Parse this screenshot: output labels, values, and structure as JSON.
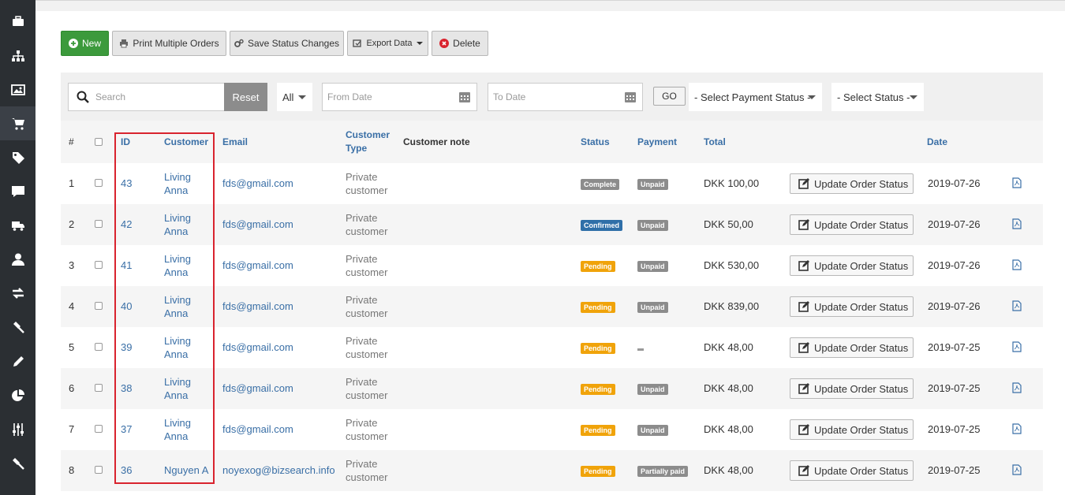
{
  "sidebar": {
    "icons": [
      "briefcase-icon",
      "sitemap-icon",
      "image-icon",
      "cart-icon",
      "tag-icon",
      "comment-icon",
      "truck-icon",
      "user-icon",
      "exchange-icon",
      "gavel-icon",
      "pencil-icon",
      "pie-chart-icon",
      "sliders-icon",
      "hammer-icon"
    ],
    "active_index": 3
  },
  "toolbar": {
    "new_label": "New",
    "print_label": "Print Multiple Orders",
    "save_label": "Save Status Changes",
    "export_label": "Export Data",
    "delete_label": "Delete"
  },
  "filters": {
    "search_placeholder": "Search",
    "reset_label": "Reset",
    "all_label": "All",
    "from_date_placeholder": "From Date",
    "to_date_placeholder": "To Date",
    "go_label": "GO",
    "payment_status_label": "- Select Payment Status -",
    "status_label": "- Select Status -"
  },
  "table": {
    "headers": {
      "num": "#",
      "id": "ID",
      "customer": "Customer",
      "email": "Email",
      "customer_type": "Customer Type",
      "customer_note": "Customer note",
      "status": "Status",
      "payment": "Payment",
      "total": "Total",
      "date": "Date"
    },
    "update_label": "Update Order Status",
    "rows": [
      {
        "num": "1",
        "id": "43",
        "customer": "Living Anna",
        "email": "fds@gmail.com",
        "type": "Private customer",
        "status": "Complete",
        "payment": "Unpaid",
        "total": "DKK 100,00",
        "date": "2019-07-26"
      },
      {
        "num": "2",
        "id": "42",
        "customer": "Living Anna",
        "email": "fds@gmail.com",
        "type": "Private customer",
        "status": "Confirmed",
        "payment": "Unpaid",
        "total": "DKK 50,00",
        "date": "2019-07-26"
      },
      {
        "num": "3",
        "id": "41",
        "customer": "Living Anna",
        "email": "fds@gmail.com",
        "type": "Private customer",
        "status": "Pending",
        "payment": "Unpaid",
        "total": "DKK 530,00",
        "date": "2019-07-26"
      },
      {
        "num": "4",
        "id": "40",
        "customer": "Living Anna",
        "email": "fds@gmail.com",
        "type": "Private customer",
        "status": "Pending",
        "payment": "Unpaid",
        "total": "DKK 839,00",
        "date": "2019-07-26"
      },
      {
        "num": "5",
        "id": "39",
        "customer": "Living Anna",
        "email": "fds@gmail.com",
        "type": "Private customer",
        "status": "Pending",
        "payment": "",
        "total": "DKK 48,00",
        "date": "2019-07-25"
      },
      {
        "num": "6",
        "id": "38",
        "customer": "Living Anna",
        "email": "fds@gmail.com",
        "type": "Private customer",
        "status": "Pending",
        "payment": "Unpaid",
        "total": "DKK 48,00",
        "date": "2019-07-25"
      },
      {
        "num": "7",
        "id": "37",
        "customer": "Living Anna",
        "email": "fds@gmail.com",
        "type": "Private customer",
        "status": "Pending",
        "payment": "Unpaid",
        "total": "DKK 48,00",
        "date": "2019-07-25"
      },
      {
        "num": "8",
        "id": "36",
        "customer": "Nguyen A",
        "email": "noyexog@bizsearch.info",
        "type": "Private customer",
        "status": "Pending",
        "payment": "Partially paid",
        "total": "DKK 48,00",
        "date": "2019-07-25"
      }
    ]
  },
  "colors": {
    "complete": "#8c8c8c",
    "confirmed": "#2f6fa8",
    "pending": "#f0a30a",
    "payment_badge": "#8c8c8c",
    "highlight": "#d9232e",
    "link": "#3a6fa6"
  }
}
